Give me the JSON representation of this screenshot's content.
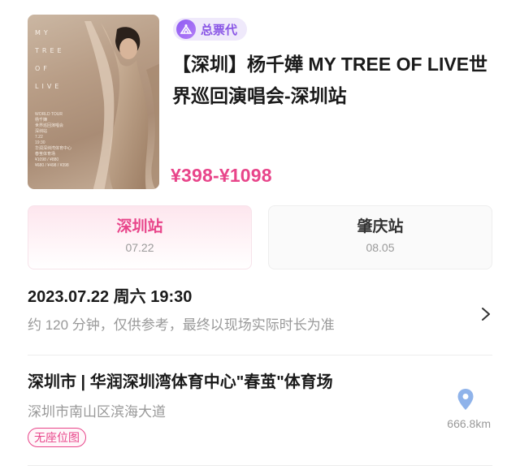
{
  "poster": {
    "title_lines": [
      "MY",
      "TREE",
      "OF",
      "LIVE"
    ],
    "small_text": "WORLD TOUR\n杨千嬅\n世界巡回演唱会\n深圳站\n7.22\n19:30\n华润深圳湾体育中心\n春茧体育场\n¥1098 / ¥880\n¥680 / ¥498 / ¥398"
  },
  "badge": {
    "label": "总票代",
    "icon": "ticket-agent-icon"
  },
  "event": {
    "title": "【深圳】杨千嬅 MY TREE OF LIVE世界巡回演唱会-深圳站",
    "price_range": "¥398-¥1098"
  },
  "cities": [
    {
      "name": "深圳站",
      "date": "07.22",
      "selected": true
    },
    {
      "name": "肇庆站",
      "date": "08.05",
      "selected": false
    }
  ],
  "schedule": {
    "datetime": "2023.07.22 周六 19:30",
    "duration_note": "约 120 分钟，仅供参考，最终以现场实际时长为准"
  },
  "venue": {
    "name": "深圳市 | 华润深圳湾体育中心\"春茧\"体育场",
    "address": "深圳市南山区滨海大道",
    "seat_tag": "无座位图",
    "distance": "666.8km"
  },
  "colors": {
    "accent": "#e8458a",
    "badge": "#8a57e6",
    "muted": "#999999"
  }
}
